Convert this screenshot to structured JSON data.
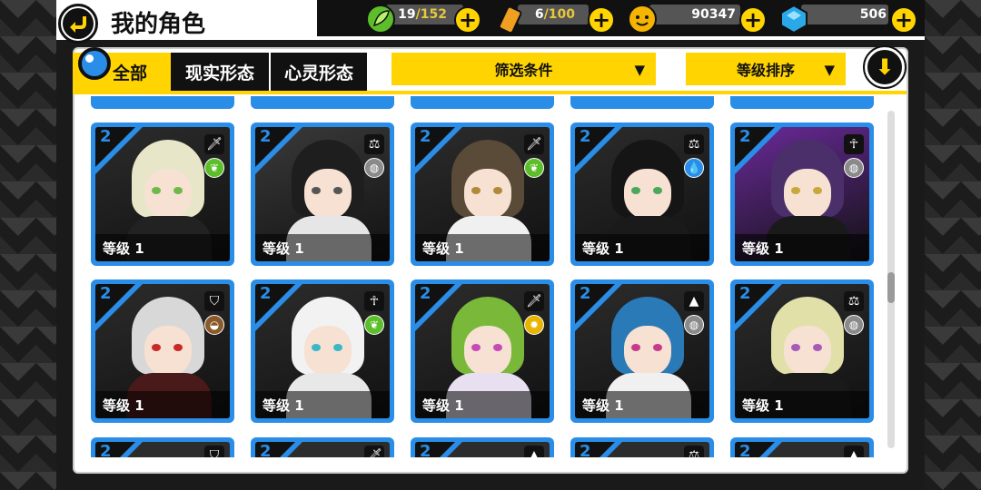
{
  "header": {
    "title": "我的角色",
    "resources": [
      {
        "icon": "leaf-icon",
        "current": "19",
        "max": "/152"
      },
      {
        "icon": "battery-icon",
        "current": "6",
        "max": "/100"
      },
      {
        "icon": "coin-icon",
        "current": "90347",
        "max": ""
      },
      {
        "icon": "crystal-icon",
        "current": "506",
        "max": ""
      }
    ],
    "plus_label": "+"
  },
  "tabs": [
    {
      "label": "全部",
      "active": true
    },
    {
      "label": "现实形态",
      "active": false
    },
    {
      "label": "心灵形态",
      "active": false
    }
  ],
  "filters": {
    "filter_label": "筛选条件",
    "sort_label": "等级排序",
    "arrow": "▼",
    "down_arrow": "⬇"
  },
  "cards": [
    {
      "star": "2",
      "level": "等级 1",
      "class_icon": "sword-icon",
      "class_glyph": "🗡",
      "element_icon": "leaf-element-icon",
      "element_glyph": "❦",
      "element_color": "#5cbf2a",
      "hair": "#e8e6c8",
      "bg": "#2c2c2c",
      "eyes": "#6fb84a",
      "body": "#222"
    },
    {
      "star": "2",
      "level": "等级 1",
      "class_icon": "balance-icon",
      "class_glyph": "⚖",
      "element_icon": "wind-element-icon",
      "element_glyph": "◍",
      "element_color": "#8a8a8a",
      "hair": "#1e1e1e",
      "bg": "#3a3a3a",
      "eyes": "#555",
      "body": "#e6e6e6"
    },
    {
      "star": "2",
      "level": "等级 1",
      "class_icon": "sword-icon",
      "class_glyph": "🗡",
      "element_icon": "leaf-element-icon",
      "element_glyph": "❦",
      "element_color": "#5cbf2a",
      "hair": "#5a4a38",
      "bg": "#2c2c2c",
      "eyes": "#b08a3a",
      "body": "#f0f0f0"
    },
    {
      "star": "2",
      "level": "等级 1",
      "class_icon": "balance-icon",
      "class_glyph": "⚖",
      "element_icon": "water-element-icon",
      "element_glyph": "💧",
      "element_color": "#2a8ee8",
      "hair": "#151515",
      "bg": "#2c2c2c",
      "eyes": "#4aa85a",
      "body": "#1a1a1a"
    },
    {
      "star": "2",
      "level": "等级 1",
      "class_icon": "ankh-icon",
      "class_glyph": "☥",
      "element_icon": "wind-element-icon",
      "element_glyph": "◍",
      "element_color": "#8a8a8a",
      "hair": "#4a2f6a",
      "bg": "#6a2a9a",
      "eyes": "#c8a83a",
      "body": "#1a1a1a"
    },
    {
      "star": "2",
      "level": "等级 1",
      "class_icon": "shield-icon",
      "class_glyph": "⛉",
      "element_icon": "earth-element-icon",
      "element_glyph": "◒",
      "element_color": "#8a5a2a",
      "hair": "#d8d8d8",
      "bg": "#2c2c2c",
      "eyes": "#c82a2a",
      "body": "#4a1a1a"
    },
    {
      "star": "2",
      "level": "等级 1",
      "class_icon": "ankh-icon",
      "class_glyph": "☥",
      "element_icon": "leaf-element-icon",
      "element_glyph": "❦",
      "element_color": "#5cbf2a",
      "hair": "#f2f2f2",
      "bg": "#2c2c2c",
      "eyes": "#3ab8c8",
      "body": "#e8e8e8"
    },
    {
      "star": "2",
      "level": "等级 1",
      "class_icon": "sword-icon",
      "class_glyph": "🗡",
      "element_icon": "light-element-icon",
      "element_glyph": "✹",
      "element_color": "#e8b400",
      "hair": "#7ab83a",
      "bg": "#2c2c2c",
      "eyes": "#c84ab8",
      "body": "#e8e0f0"
    },
    {
      "star": "2",
      "level": "等级 1",
      "class_icon": "triforce-icon",
      "class_glyph": "▲",
      "element_icon": "wind-element-icon",
      "element_glyph": "◍",
      "element_color": "#8a8a8a",
      "hair": "#2a7ab8",
      "bg": "#2c2c2c",
      "eyes": "#c83a8a",
      "body": "#f0f0f0"
    },
    {
      "star": "2",
      "level": "等级 1",
      "class_icon": "balance-icon",
      "class_glyph": "⚖",
      "element_icon": "wind-element-icon",
      "element_glyph": "◍",
      "element_color": "#8a8a8a",
      "hair": "#e0e0a8",
      "bg": "#2c2c2c",
      "eyes": "#a85ab8",
      "body": "#1a1a1a"
    }
  ],
  "partial_cards": [
    {
      "star": "2",
      "class_icon": "shield-icon",
      "class_glyph": "⛉"
    },
    {
      "star": "2",
      "class_icon": "sword-icon",
      "class_glyph": "🗡"
    },
    {
      "star": "2",
      "class_icon": "triforce-icon",
      "class_glyph": "▲"
    },
    {
      "star": "2",
      "class_icon": "balance-icon",
      "class_glyph": "⚖"
    },
    {
      "star": "2",
      "class_icon": "triforce-icon",
      "class_glyph": "▲"
    }
  ],
  "colors": {
    "accent_yellow": "#ffd400",
    "card_blue": "#2a8ee8",
    "dark": "#111111"
  }
}
